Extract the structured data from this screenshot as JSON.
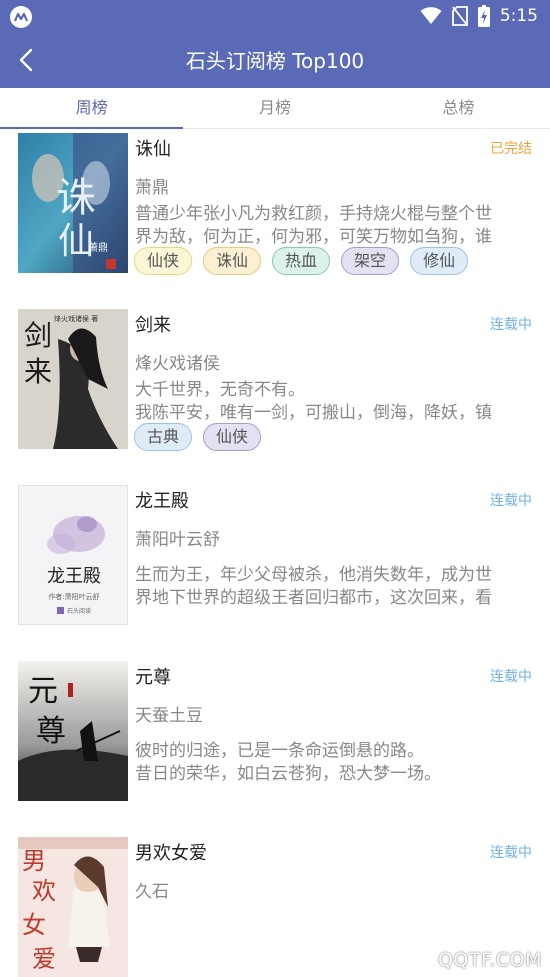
{
  "status_bar": {
    "time": "5:15"
  },
  "header": {
    "title": "石头订阅榜 Top100"
  },
  "tabs": [
    {
      "label": "周榜"
    },
    {
      "label": "月榜"
    },
    {
      "label": "总榜"
    }
  ],
  "books": [
    {
      "title": "诛仙",
      "status": "已完结",
      "author": "萧鼎",
      "desc": [
        "普通少年张小凡为救红颜，手持烧火棍与整个世",
        "界为敌，何为正，何为邪，可笑万物如刍狗，谁"
      ],
      "tags": [
        "仙侠",
        "诛仙",
        "热血",
        "架空",
        "修仙"
      ],
      "cover_text": [
        "诛",
        "仙",
        "萧鼎"
      ]
    },
    {
      "title": "剑来",
      "status": "连载中",
      "author": "烽火戏诸侯",
      "desc": [
        "大千世界，无奇不有。",
        "我陈平安，唯有一剑，可搬山，倒海，降妖，镇"
      ],
      "tags": [
        "古典",
        "仙侠"
      ],
      "cover_text": [
        "剑",
        "来",
        "烽火戏诸侯 著"
      ]
    },
    {
      "title": "龙王殿",
      "status": "连载中",
      "author": "萧阳叶云舒",
      "desc": [
        "生而为王，年少父母被杀，他消失数年，成为世",
        "界地下世界的超级王者回归都市，这次回来，看"
      ],
      "tags": [],
      "cover_text": [
        "龙王殿",
        "作者:萧阳叶云舒",
        "石头阅读"
      ]
    },
    {
      "title": "元尊",
      "status": "连载中",
      "author": "天蚕土豆",
      "desc": [
        "彼时的归途，已是一条命运倒悬的路。",
        "昔日的荣华，如白云苍狗，恐大梦一场。"
      ],
      "tags": [],
      "cover_text": [
        "元",
        "尊"
      ]
    },
    {
      "title": "男欢女爱",
      "status": "连载中",
      "author": "久石",
      "desc": [
        "",
        ""
      ],
      "tags": [],
      "cover_text": [
        "男",
        "欢",
        "女",
        "爱"
      ]
    }
  ],
  "watermark": "QQTF.COM",
  "colors": {
    "primary": "#5b6ab7",
    "status_finished": "#f0a23a",
    "status_ongoing": "#6fb3e6"
  }
}
